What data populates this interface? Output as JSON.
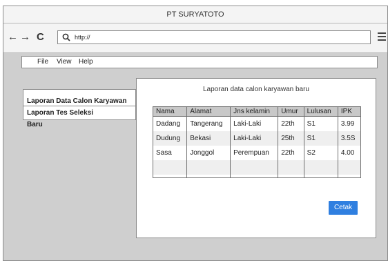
{
  "window": {
    "title": "PT SURYATOTO"
  },
  "nav": {
    "back_glyph": "←",
    "forward_glyph": "→",
    "reload_glyph": "C",
    "url": "http://"
  },
  "menu": {
    "file": "File",
    "view": "View",
    "help": "Help"
  },
  "sidebar": {
    "items": [
      {
        "label": "Laporan Data Calon Karyawan Baru"
      },
      {
        "label": "Laporan Tes Seleksi"
      }
    ]
  },
  "dialog": {
    "title": "Laporan data calon karyawan baru",
    "columns": [
      "Nama",
      "Alamat",
      "Jns kelamin",
      "Umur",
      "Lulusan",
      "IPK"
    ],
    "rows": [
      [
        "Dadang",
        "Tangerang",
        "Laki-Laki",
        "22th",
        "S1",
        "3.99"
      ],
      [
        "Dudung",
        "Bekasi",
        "Laki-Laki",
        "25th",
        "S1",
        "3.5S"
      ],
      [
        "Sasa",
        "Jonggol",
        "Perempuan",
        "22th",
        "S2",
        "4.00"
      ],
      [
        "",
        "",
        "",
        "",
        "",
        ""
      ]
    ],
    "print_label": "Cetak"
  },
  "colors": {
    "accent": "#2f7fe0",
    "window_bg": "#cfcfcf",
    "header_bg": "#c8c8c8"
  }
}
